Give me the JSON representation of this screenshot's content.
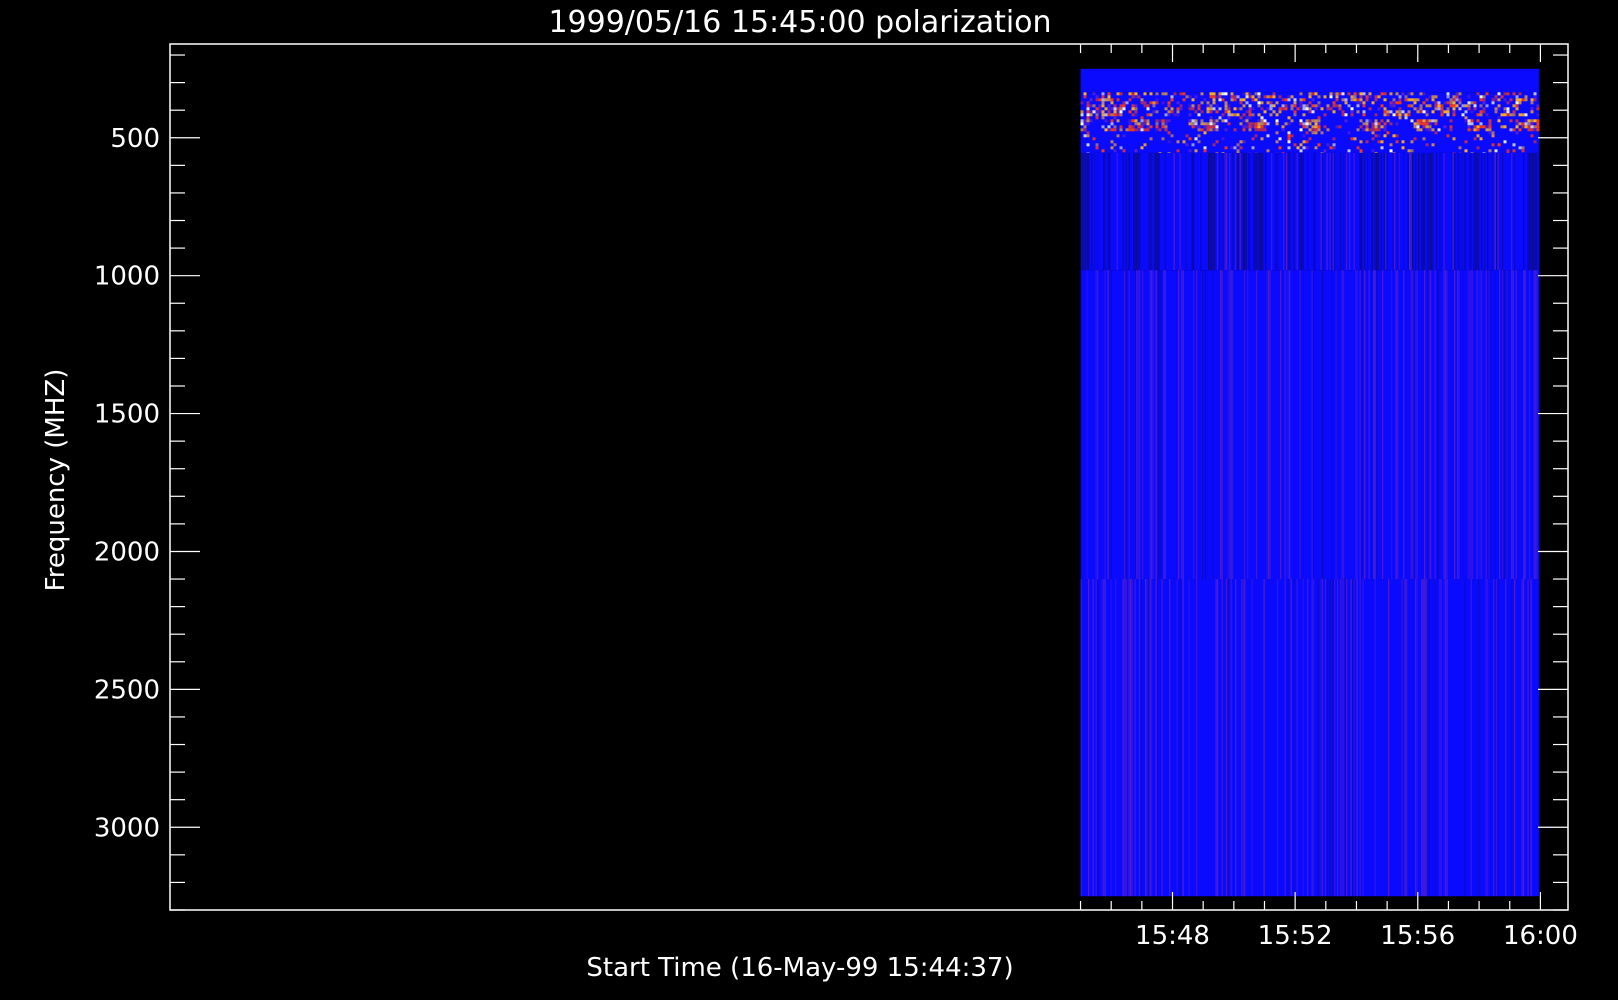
{
  "chart_data": {
    "type": "heatmap",
    "title": "1999/05/16 15:45:00 polarization",
    "xlabel": "Start Time (16-May-99 15:44:37)",
    "ylabel": "Frequency (MHZ)",
    "x_range_minutes": [
      15.3,
      60.9
    ],
    "x_data_extent_minutes": [
      45.0,
      59.95
    ],
    "y_range": [
      3300,
      160
    ],
    "y_data_extent": [
      3250,
      250
    ],
    "x_ticks": [
      {
        "label": "15:48",
        "minute": 48
      },
      {
        "label": "15:52",
        "minute": 52
      },
      {
        "label": "15:56",
        "minute": 56
      },
      {
        "label": "16:00",
        "minute": 60
      }
    ],
    "y_ticks": [
      {
        "label": "500",
        "value": 500
      },
      {
        "label": "1000",
        "value": 1000
      },
      {
        "label": "1500",
        "value": 1500
      },
      {
        "label": "2000",
        "value": 2000
      },
      {
        "label": "2500",
        "value": 2500
      },
      {
        "label": "3000",
        "value": 3000
      }
    ],
    "bands": [
      {
        "name": "blank-top",
        "freq": [
          250,
          335
        ],
        "style": "flat"
      },
      {
        "name": "noisy-burst",
        "freq": [
          335,
          555
        ],
        "style": "bursty"
      },
      {
        "name": "dark-striped",
        "freq": [
          555,
          980
        ],
        "style": "dark-striped"
      },
      {
        "name": "blue-striped-mid",
        "freq": [
          980,
          2100
        ],
        "style": "striped"
      },
      {
        "name": "blue-striped-low",
        "freq": [
          2100,
          3250
        ],
        "style": "striped"
      }
    ],
    "burst_windows_minutes": [
      [
        45.0,
        45.25
      ],
      [
        45.7,
        46.1
      ],
      [
        46.45,
        47.2
      ],
      [
        47.4,
        47.75
      ],
      [
        48.45,
        49.45
      ],
      [
        50.2,
        51.1
      ],
      [
        52.1,
        52.8
      ],
      [
        54.1,
        54.9
      ],
      [
        55.8,
        56.6
      ],
      [
        57.45,
        58.35
      ],
      [
        59.15,
        59.95
      ]
    ],
    "colors": {
      "background": "#000000",
      "base": "#0a0aff",
      "dark": "#0c0c86",
      "stripe": "#5a22c8",
      "burst_hot": "#ffb020",
      "burst_white": "#ffffff",
      "burst_red": "#ff3a10",
      "axis": "#ffffff"
    },
    "grid": false,
    "legend": "none"
  }
}
